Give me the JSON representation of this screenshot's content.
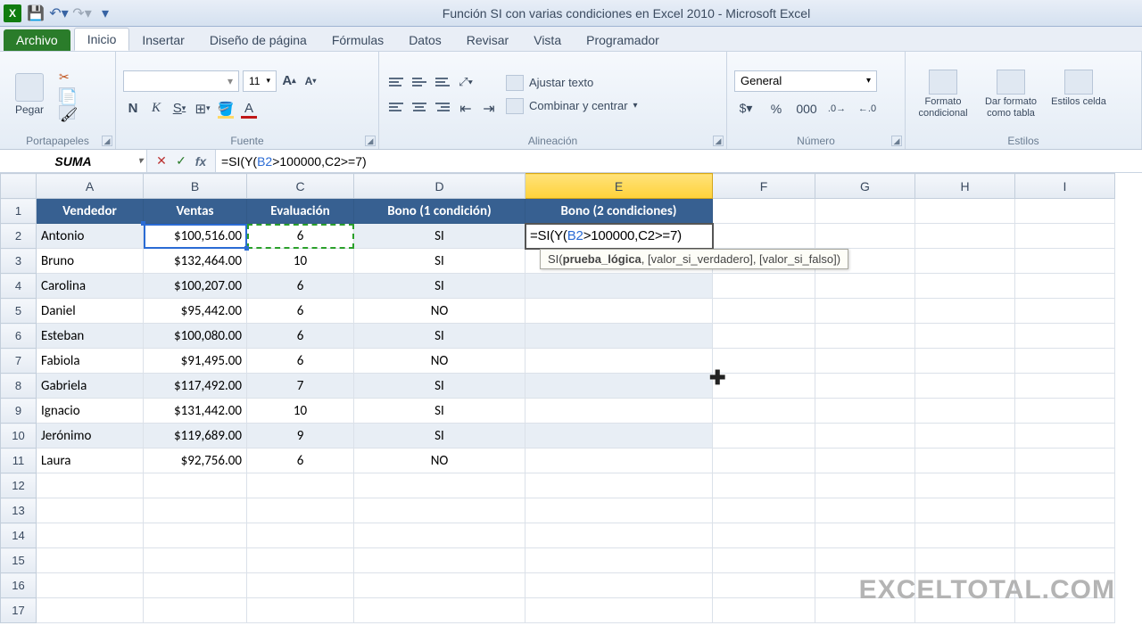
{
  "title": "Función SI con varias condiciones en Excel 2010  -  Microsoft Excel",
  "tabs": {
    "archivo": "Archivo",
    "inicio": "Inicio",
    "insertar": "Insertar",
    "diseno": "Diseño de página",
    "formulas": "Fórmulas",
    "datos": "Datos",
    "revisar": "Revisar",
    "vista": "Vista",
    "programador": "Programador"
  },
  "ribbon": {
    "pegar": "Pegar",
    "portapapeles": "Portapapeles",
    "fuente": "Fuente",
    "font_size": "11",
    "alineacion": "Alineación",
    "ajustar": "Ajustar texto",
    "combinar": "Combinar y centrar",
    "numero": "Número",
    "general": "General",
    "estilos": "Estilos",
    "formato_cond": "Formato condicional",
    "dar_formato": "Dar formato como tabla",
    "estilos_celda": "Estilos celda"
  },
  "fbar": {
    "namebox": "SUMA",
    "formula": "=SI(Y(B2>100000,C2>=7)"
  },
  "columns": [
    "A",
    "B",
    "C",
    "D",
    "E",
    "F",
    "G",
    "H",
    "I"
  ],
  "headers": {
    "A": "Vendedor",
    "B": "Ventas",
    "C": "Evaluación",
    "D": "Bono (1 condición)",
    "E": "Bono (2 condiciones)"
  },
  "rows": [
    {
      "n": 2,
      "a": "Antonio",
      "b": "$100,516.00",
      "c": "6",
      "d": "SI",
      "e": "=SI(Y(B2>100000,C2>=7)"
    },
    {
      "n": 3,
      "a": "Bruno",
      "b": "$132,464.00",
      "c": "10",
      "d": "SI",
      "e": ""
    },
    {
      "n": 4,
      "a": "Carolina",
      "b": "$100,207.00",
      "c": "6",
      "d": "SI",
      "e": ""
    },
    {
      "n": 5,
      "a": "Daniel",
      "b": "$95,442.00",
      "c": "6",
      "d": "NO",
      "e": ""
    },
    {
      "n": 6,
      "a": "Esteban",
      "b": "$100,080.00",
      "c": "6",
      "d": "SI",
      "e": ""
    },
    {
      "n": 7,
      "a": "Fabiola",
      "b": "$91,495.00",
      "c": "6",
      "d": "NO",
      "e": ""
    },
    {
      "n": 8,
      "a": "Gabriela",
      "b": "$117,492.00",
      "c": "7",
      "d": "SI",
      "e": ""
    },
    {
      "n": 9,
      "a": "Ignacio",
      "b": "$131,442.00",
      "c": "10",
      "d": "SI",
      "e": ""
    },
    {
      "n": 10,
      "a": "Jerónimo",
      "b": "$119,689.00",
      "c": "9",
      "d": "SI",
      "e": ""
    },
    {
      "n": 11,
      "a": "Laura",
      "b": "$92,756.00",
      "c": "6",
      "d": "NO",
      "e": ""
    }
  ],
  "tooltip": {
    "fn": "SI",
    "arg1": "prueba_lógica",
    "arg2": "[valor_si_verdadero]",
    "arg3": "[valor_si_falso]"
  },
  "watermark": "EXCELTOTAL.COM"
}
